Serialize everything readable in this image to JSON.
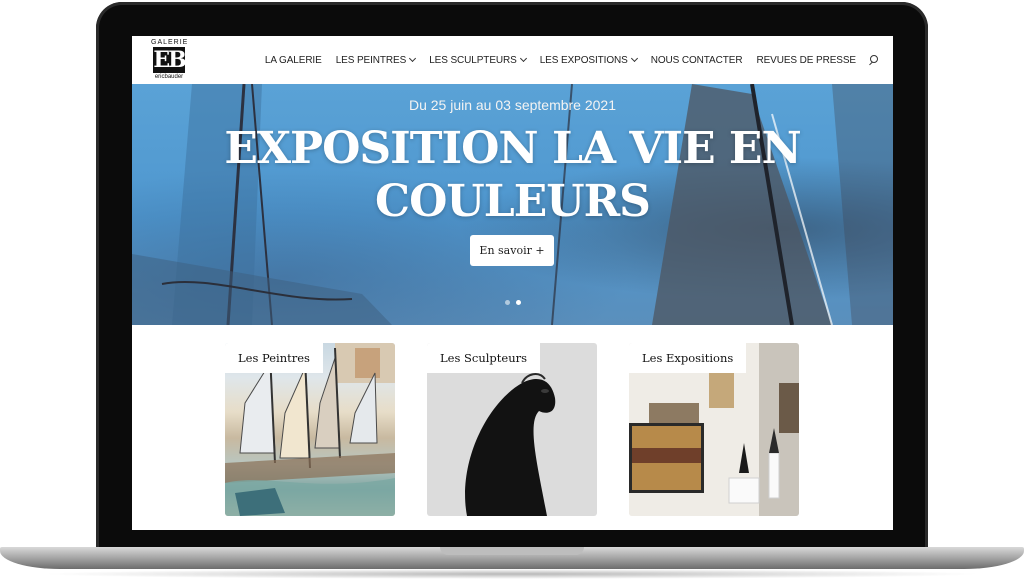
{
  "logo": {
    "top": "GALERIE",
    "mark": "EB",
    "bottom": "ericbauder"
  },
  "nav": {
    "items": [
      {
        "label": "LA GALERIE",
        "dropdown": false
      },
      {
        "label": "LES PEINTRES",
        "dropdown": true
      },
      {
        "label": "LES SCULPTEURS",
        "dropdown": true
      },
      {
        "label": "LES EXPOSITIONS",
        "dropdown": true
      },
      {
        "label": "NOUS CONTACTER",
        "dropdown": false
      },
      {
        "label": "REVUES DE PRESSE",
        "dropdown": false
      }
    ],
    "search_icon": "search-icon"
  },
  "hero": {
    "date": "Du 25 juin au 03 septembre 2021",
    "title": "EXPOSITION LA VIE EN COULEURS",
    "button": "En savoir +",
    "slides": 2,
    "active_slide": 2
  },
  "cards": [
    {
      "label": "Les Peintres"
    },
    {
      "label": "Les Sculpteurs"
    },
    {
      "label": "Les Expositions"
    }
  ],
  "colors": {
    "hero_blue": "#5aa2d6",
    "text_dark": "#222222",
    "white": "#ffffff"
  }
}
